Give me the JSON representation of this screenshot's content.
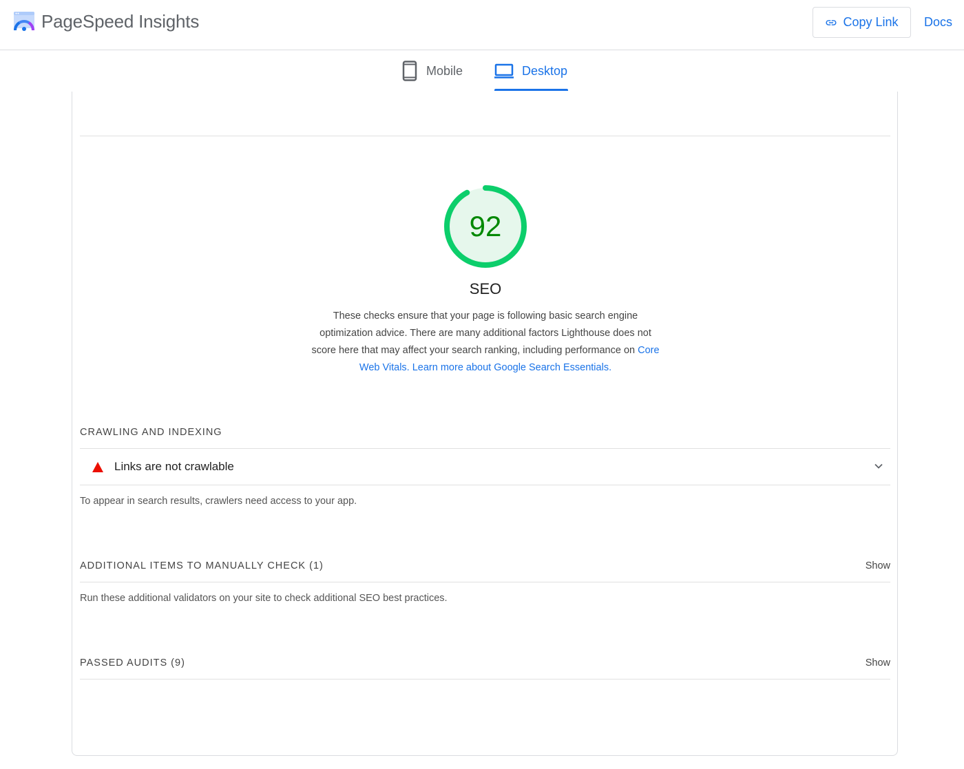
{
  "header": {
    "brand_name": "PageSpeed Insights",
    "copy_link_label": "Copy Link",
    "docs_label": "Docs"
  },
  "tabs": [
    {
      "label": "Mobile",
      "active": false
    },
    {
      "label": "Desktop",
      "active": true
    }
  ],
  "score": {
    "value": "92",
    "fraction": 0.92,
    "title": "SEO",
    "color": "#0cce6b",
    "fill": "#e6f7ec",
    "text_color": "#008800"
  },
  "description": {
    "text": "These checks ensure that your page is following basic search engine optimization advice. There are many additional factors Lighthouse does not score here that may affect your search ranking, including performance on",
    "link1": "Core Web Vitals",
    "separator": ". ",
    "link2": "Learn more about Google Search Essentials",
    "end": "."
  },
  "sections": {
    "crawling": {
      "title": "CRAWLING AND INDEXING",
      "audit_title": "Links are not crawlable",
      "audit_status_icon": "warning-triangle-icon",
      "description": "To appear in search results, crawlers need access to your app."
    },
    "manual": {
      "title": "ADDITIONAL ITEMS TO MANUALLY CHECK (1)",
      "show_label": "Show",
      "description": "Run these additional validators on your site to check additional SEO best practices."
    },
    "passed": {
      "title": "PASSED AUDITS (9)",
      "show_label": "Show"
    }
  },
  "colors": {
    "accent": "#1a73e8",
    "fail": "#eb0f00"
  }
}
